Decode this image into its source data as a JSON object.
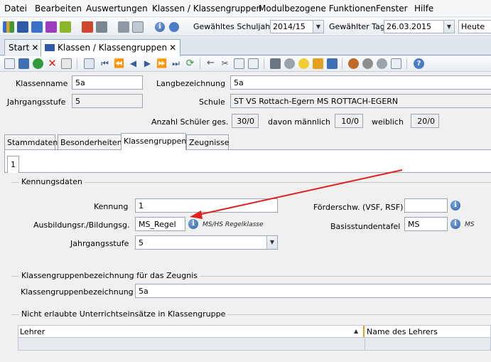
{
  "menu": [
    "Datei",
    "Bearbeiten",
    "Auswertungen",
    "Klassen / Klassengruppen",
    "Modulbezogene Funktionen",
    "Fenster",
    "Hilfe"
  ],
  "toolbar": {
    "schuljahr_label": "Gewähltes Schuljahr",
    "schuljahr_value": "2014/15",
    "tag_label": "Gewählter Tag",
    "tag_value": "26.03.2015",
    "heute_button": "Heute"
  },
  "tabs": [
    {
      "label": "Start"
    },
    {
      "label": "Klassen / Klassengruppen"
    }
  ],
  "header": {
    "klassenname_label": "Klassenname",
    "klassenname_value": "5a",
    "langbezeichnung_label": "Langbezeichnung",
    "langbezeichnung_value": "5a",
    "jahrgangsstufe_label": "Jahrgangsstufe",
    "jahrgangsstufe_value": "5",
    "schule_label": "Schule",
    "schule_value": "ST VS Rottach-Egern MS ROTTACH-EGERN",
    "anzahl_label": "Anzahl Schüler ges.",
    "anzahl_value": "30/0",
    "maennlich_label": "davon männlich",
    "maennlich_value": "10/0",
    "weiblich_label": "weiblich",
    "weiblich_value": "20/0"
  },
  "section_tabs": [
    "Stammdaten",
    "Besonderheiten",
    "Klassengruppen",
    "Zeugnisse"
  ],
  "sub_tab": "1",
  "kennungsdaten": {
    "title": "Kennungsdaten",
    "kennung_label": "Kennung",
    "kennung_value": "1",
    "ausbildung_label": "Ausbildungsr./Bildungsg.",
    "ausbildung_value": "MS_Regel",
    "ausbildung_hint": "MS/HS Regelklasse",
    "jahrgangsstufe_label": "Jahrgangsstufe",
    "jahrgangsstufe_value": "5",
    "foerder_label": "Förderschw. (VSF, RSF)",
    "foerder_value": "",
    "basis_label": "Basisstundentafel",
    "basis_value": "MS",
    "basis_hint": "MS"
  },
  "zeugnis": {
    "title": "Klassengruppenbezeichnung für das Zeugnis",
    "label": "Klassengruppenbezeichnung",
    "value": "5a"
  },
  "unterricht": {
    "title": "Nicht erlaubte Unterrichtseinsätze in Klassengruppe",
    "columns": [
      "Lehrer",
      "Name des Lehrers"
    ]
  },
  "colors": {
    "annotation_arrow": "#e02020",
    "window_bg": "#f0f0f0",
    "accent": "#2d5fa8"
  }
}
